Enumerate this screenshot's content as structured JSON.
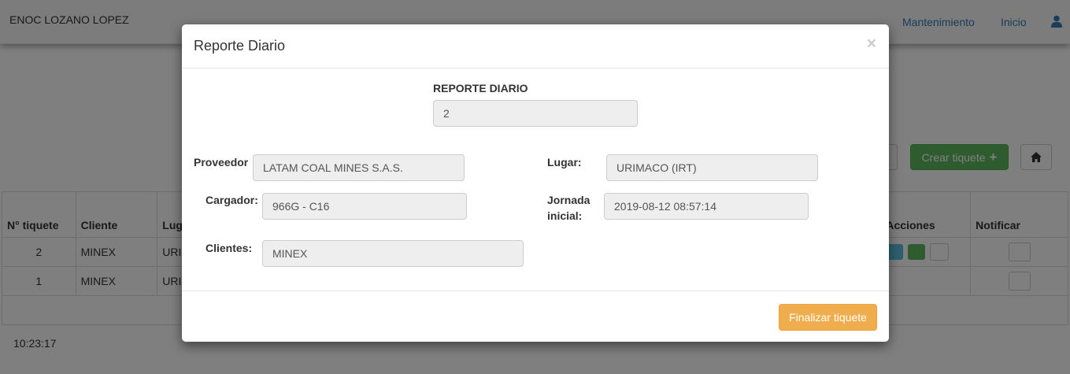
{
  "navbar": {
    "user_name": "ENOC LOZANO LOPEZ",
    "link_mantenimiento": "Mantenimiento",
    "link_inicio": "Inicio",
    "user_icon": "user-icon",
    "link_color": "#337ab7"
  },
  "toolbar": {
    "create_label": "Crear tiquete",
    "create_icon": "plus-icon",
    "home_icon": "home-icon",
    "create_color": "#5cb85c"
  },
  "table": {
    "headers": {
      "num": "N° tiquete",
      "cliente": "Cliente",
      "lugar": "Lug",
      "acciones": "Acciones",
      "notificar": "Notificar"
    },
    "rows": [
      {
        "num": "2",
        "cliente": "MINEX",
        "lugar": "URI"
      },
      {
        "num": "1",
        "cliente": "MINEX",
        "lugar": "URI"
      }
    ]
  },
  "clock": "10:23:17",
  "modal": {
    "title": "Reporte Diario",
    "close": "×",
    "reporte_label": "REPORTE DIARIO",
    "reporte_value": "2",
    "proveedor_label": "Proveedor",
    "proveedor_value": "LATAM COAL MINES S.A.S.",
    "lugar_label": "Lugar:",
    "lugar_value": "URIMACO (IRT)",
    "cargador_label": "Cargador:",
    "cargador_value": "966G - C16",
    "jornada_label_1": "Jornada",
    "jornada_label_2": "inicial:",
    "jornada_value": "2019-08-12  08:57:14",
    "clientes_label": "Clientes:",
    "clientes_value": "MINEX",
    "finalizar_label": "Finalizar tiquete",
    "finalizar_color": "#f0ad4e"
  }
}
